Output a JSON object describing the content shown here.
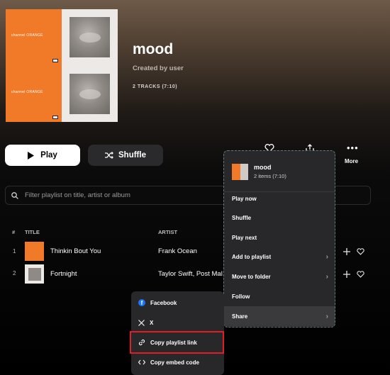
{
  "playlist": {
    "title": "mood",
    "creator": "Created by user",
    "meta": "2 TRACKS  (7:10)",
    "cover_text": "channel ORANGE"
  },
  "actions": {
    "play_label": "Play",
    "shuffle_label": "Shuffle",
    "more_label": "More"
  },
  "filter": {
    "placeholder": "Filter playlist on title, artist or album"
  },
  "table": {
    "headers": {
      "num": "#",
      "title": "TITLE",
      "artist": "ARTIST"
    },
    "rows": [
      {
        "num": "1",
        "title": "Thinkin Bout You",
        "artist": "Frank Ocean"
      },
      {
        "num": "2",
        "title": "Fortnight",
        "artist": "Taylor Swift, Post Mal"
      }
    ]
  },
  "context_menu": {
    "name": "mood",
    "sub": "2 items (7:10)",
    "items": [
      {
        "label": "Play now"
      },
      {
        "label": "Shuffle"
      },
      {
        "label": "Play next"
      },
      {
        "label": "Add to playlist",
        "chevron": "chevron-right-icon"
      },
      {
        "label": "Move to folder",
        "chevron": "chevron-right-icon"
      },
      {
        "label": "Follow"
      },
      {
        "label": "Share",
        "chevron": "chevron-right-icon",
        "active": true
      }
    ]
  },
  "share_menu": {
    "items": [
      {
        "label": "Facebook",
        "icon": "facebook-icon"
      },
      {
        "label": "X",
        "icon": "x-logo-icon"
      },
      {
        "label": "Copy playlist link",
        "icon": "link-icon"
      },
      {
        "label": "Copy embed code",
        "icon": "code-icon"
      }
    ]
  },
  "colors": {
    "accent_orange": "#f07a27",
    "highlight_border": "#e11d26",
    "menu_bg": "#28282a"
  }
}
